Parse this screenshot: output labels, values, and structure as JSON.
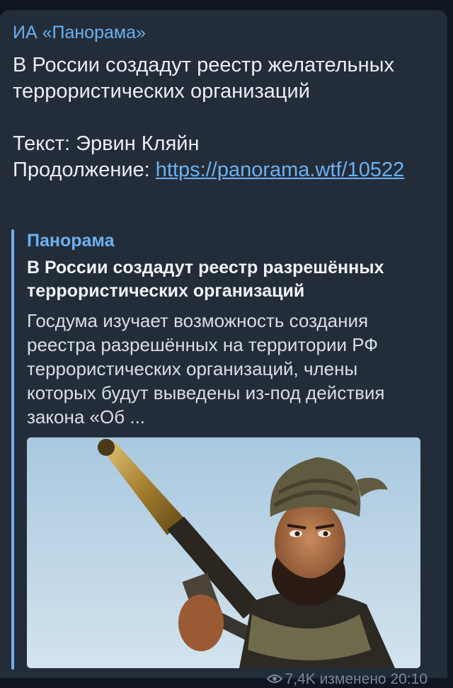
{
  "channel": {
    "name": "ИА «Панорама»"
  },
  "post": {
    "headline": "В России создадут реестр желательных террористических организаций",
    "author_line": "Текст: Эрвин Кляйн",
    "continuation_label": "Продолжение: ",
    "link_text": "https://panorama.wtf/10522"
  },
  "link_preview": {
    "site_name": "Панорама",
    "title": "В России создадут реестр разрешённых террористических организаций",
    "description": "Госдума изучает возможность создания реестра разрешённых на территории РФ террористических организаций, члены которых будут выведены из-под действия закона «Об ..."
  },
  "meta": {
    "views": "7,4K",
    "status": "изменено 20:10"
  },
  "icons": {
    "views": "eye-icon"
  },
  "colors": {
    "accent": "#6cb1f0",
    "bubble": "#232d3a",
    "background": "#0e1621"
  }
}
